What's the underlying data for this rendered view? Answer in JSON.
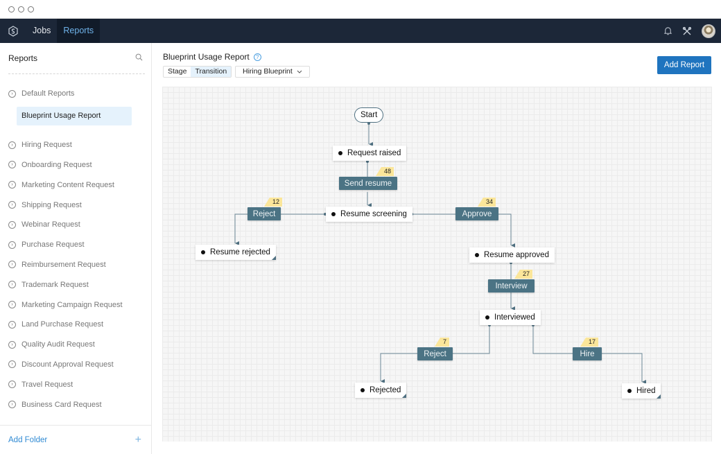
{
  "window": {
    "controls": [
      "close",
      "minimize",
      "maximize"
    ]
  },
  "topnav": {
    "logo_icon": "app-logo-icon",
    "items": [
      {
        "label": "Jobs",
        "active": false
      },
      {
        "label": "Reports",
        "active": true
      }
    ],
    "right_icons": [
      "bell-icon",
      "tools-icon",
      "avatar"
    ]
  },
  "sidebar": {
    "title": "Reports",
    "search_icon": "search-icon",
    "folders": [
      {
        "label": "Default Reports",
        "children": [
          "Blueprint Usage Report"
        ]
      },
      {
        "label": "Hiring Request"
      },
      {
        "label": "Onboarding Request"
      },
      {
        "label": "Marketing Content Request"
      },
      {
        "label": "Shipping Request"
      },
      {
        "label": "Webinar Request"
      },
      {
        "label": "Purchase Request"
      },
      {
        "label": "Reimbursement Request"
      },
      {
        "label": "Trademark Request"
      },
      {
        "label": "Marketing Campaign Request"
      },
      {
        "label": "Land Purchase Request"
      },
      {
        "label": "Quality Audit Request"
      },
      {
        "label": "Discount Approval Request"
      },
      {
        "label": "Travel Request"
      },
      {
        "label": "Business Card Request"
      }
    ],
    "selected": "Blueprint Usage Report",
    "add_folder_label": "Add Folder",
    "add_icon": "+"
  },
  "main": {
    "title": "Blueprint Usage Report",
    "help_icon": "?",
    "view_toggle": {
      "options": [
        "Stage",
        "Transition"
      ],
      "selected": "Transition"
    },
    "blueprint_select": {
      "value": "Hiring Blueprint"
    },
    "add_report_label": "Add Report",
    "colors": {
      "accent": "#1f74bf",
      "transition": "#4b7384",
      "count_badge": "#fbe69a",
      "nav_bg": "#1c2738"
    }
  },
  "flow": {
    "start_label": "Start",
    "stages": {
      "request_raised": "Request raised",
      "resume_screening": "Resume screening",
      "resume_rejected": "Resume rejected",
      "resume_approved": "Resume approved",
      "interviewed": "Interviewed",
      "rejected": "Rejected",
      "hired": "Hired"
    },
    "transitions": {
      "send_resume": {
        "label": "Send resume",
        "count": "48"
      },
      "reject1": {
        "label": "Reject",
        "count": "12"
      },
      "approve": {
        "label": "Approve",
        "count": "34"
      },
      "interview": {
        "label": "Interview",
        "count": "27"
      },
      "reject2": {
        "label": "Reject",
        "count": "7"
      },
      "hire": {
        "label": "Hire",
        "count": "17"
      }
    }
  }
}
